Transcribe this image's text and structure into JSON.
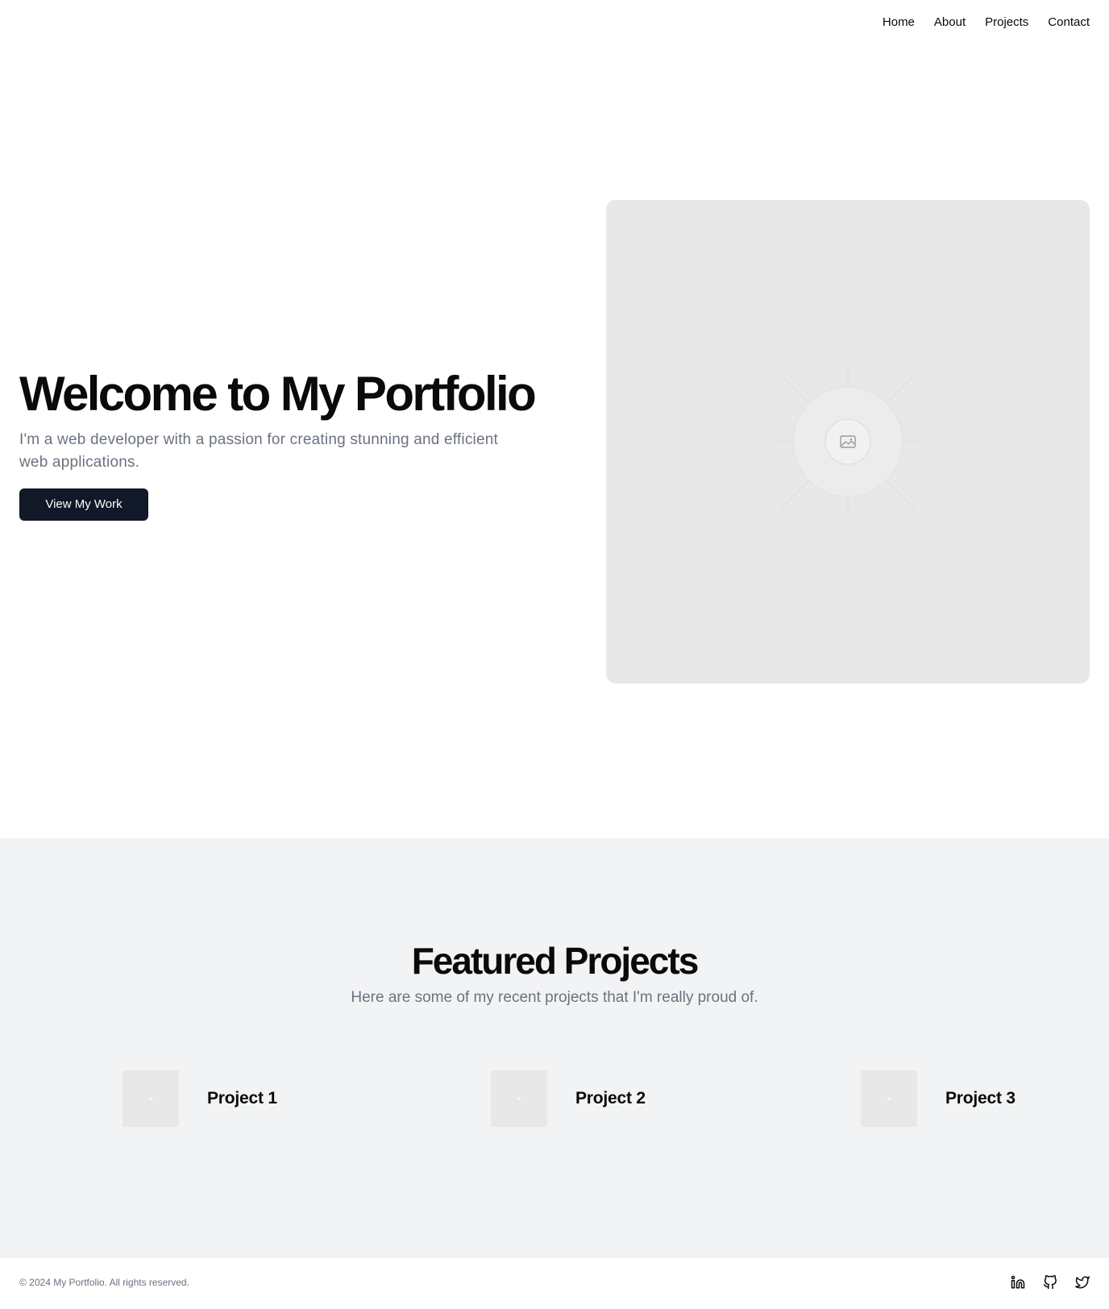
{
  "nav": {
    "items": [
      "Home",
      "About",
      "Projects",
      "Contact"
    ]
  },
  "hero": {
    "title": "Welcome to My Portfolio",
    "subtitle": "I'm a web developer with a passion for creating stunning and efficient web applications.",
    "cta_label": "View My Work",
    "image_icon": "image-placeholder-icon"
  },
  "projects": {
    "title": "Featured Projects",
    "subtitle": "Here are some of my recent projects that I'm really proud of.",
    "items": [
      {
        "name": "Project 1"
      },
      {
        "name": "Project 2"
      },
      {
        "name": "Project 3"
      }
    ]
  },
  "footer": {
    "copyright": "© 2024 My Portfolio. All rights reserved.",
    "social": [
      "linkedin-icon",
      "github-icon",
      "twitter-icon"
    ]
  },
  "colors": {
    "button_bg": "#111827",
    "muted_text": "#6b7280",
    "section_bg": "#f2f3f5",
    "placeholder_bg": "#e8e8e8"
  }
}
